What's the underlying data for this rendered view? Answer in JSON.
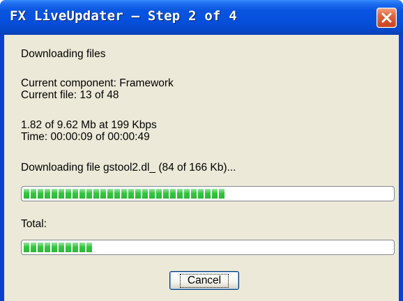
{
  "window": {
    "title": "FX LiveUpdater – Step 2 of 4",
    "close_icon": "close-icon"
  },
  "content": {
    "heading": "Downloading files",
    "current_component": "Current component: Framework",
    "current_file": "Current file: 13 of 48",
    "transfer": "1.82 of 9.62 Mb at 199 Kbps",
    "time": "Time: 00:00:09 of 00:00:49",
    "file_status": "Downloading file gstool2.dl_ (84 of 166 Kb)...",
    "file_progress": 0.55,
    "total_label": "Total:",
    "total_progress": 0.19
  },
  "buttons": {
    "cancel": "Cancel"
  },
  "colors": {
    "titlebar": "#0a55e0",
    "client_bg": "#ece9d8",
    "progress_fill": "#33c63e",
    "close_button": "#e0643a"
  }
}
